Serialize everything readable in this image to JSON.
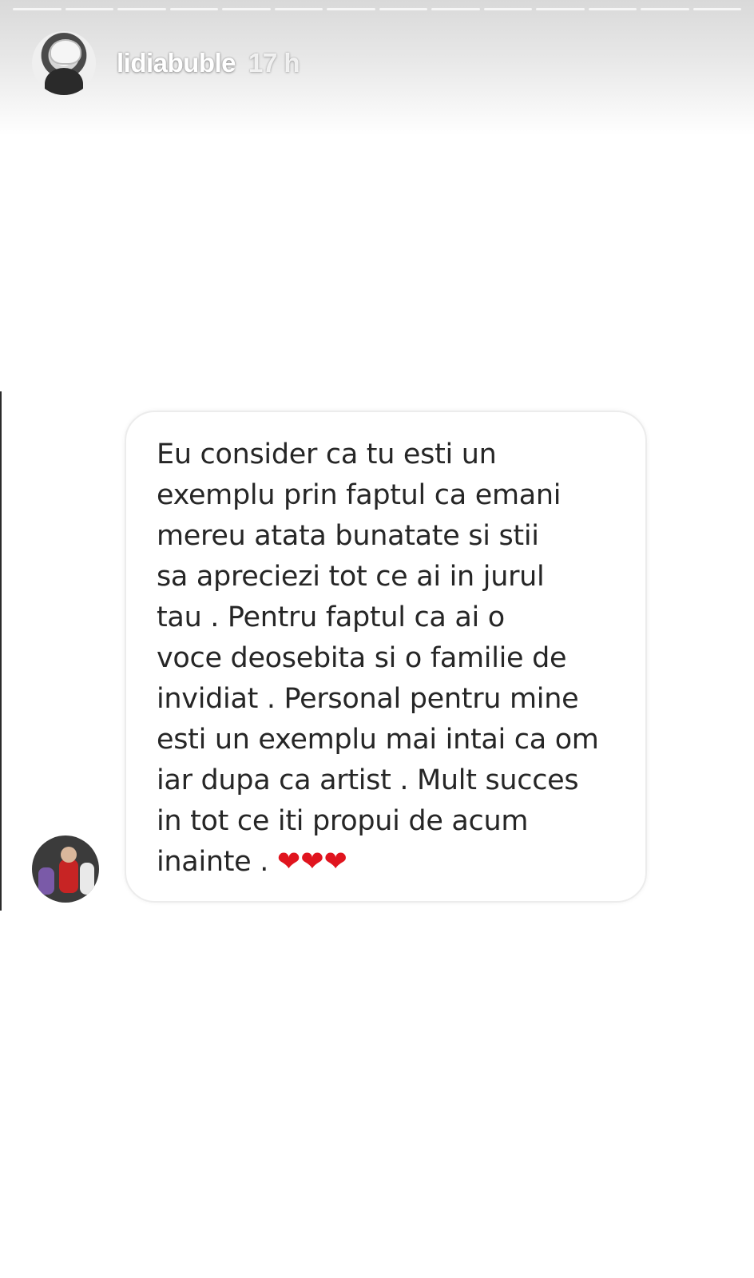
{
  "header": {
    "username": "lidiabuble",
    "timestamp": "17 h"
  },
  "story": {
    "progress_segments": 14
  },
  "message": {
    "text": "Eu consider ca tu esti un\nexemplu prin faptul ca emani\nmereu atata bunatate si stii\nsa apreciezi tot ce ai in jurul\ntau . Pentru faptul ca ai o\nvoce deosebita si o familie de\ninvidiat . Personal pentru mine\nesti un exemplu mai intai ca om\niar dupa ca artist . Mult succes\nin tot ce iti propui de acum\ninainte . ",
    "hearts": "❤❤❤"
  },
  "icons": {
    "main_avatar": "profile-avatar-icon",
    "reply_avatar": "sender-avatar-icon",
    "heart": "heart-icon"
  },
  "colors": {
    "heart": "#e0141e",
    "text": "#262626",
    "card_border": "#ececec"
  }
}
